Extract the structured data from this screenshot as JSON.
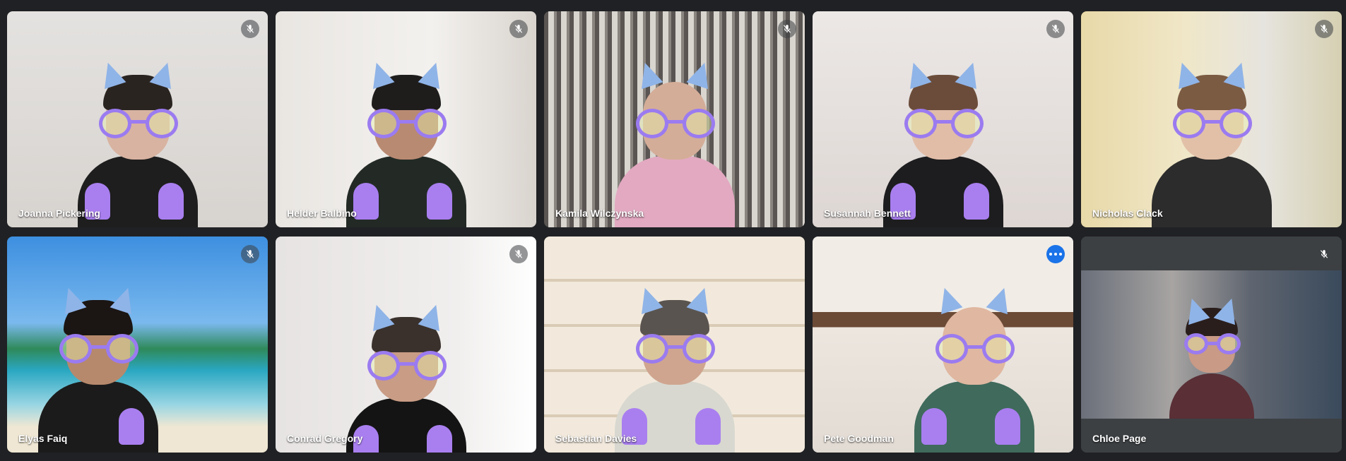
{
  "participants": [
    {
      "name": "Joanna Pickering",
      "muted": true
    },
    {
      "name": "Helder Balbino",
      "muted": true
    },
    {
      "name": "Kamila Wilczynska",
      "muted": true
    },
    {
      "name": "Susannah Bennett",
      "muted": true
    },
    {
      "name": "Nicholas Clack",
      "muted": true
    },
    {
      "name": "Elyas Faiq",
      "muted": true
    },
    {
      "name": "Conrad Gregory",
      "muted": true
    },
    {
      "name": "Sebastian Davies",
      "muted": false
    },
    {
      "name": "Pete Goodman",
      "muted": false,
      "active": true
    },
    {
      "name": "Chloe Page",
      "muted": true
    }
  ],
  "colors": {
    "background": "#202124",
    "active_border": "#8ab4f8",
    "more_button": "#1a73e8",
    "effect_glasses": "#9b7bf0",
    "effect_ears": "#8fb4e8",
    "effect_paws": "#a97ff0"
  },
  "icons": {
    "mic_off": "mic-off-icon",
    "more": "more-options-icon"
  }
}
